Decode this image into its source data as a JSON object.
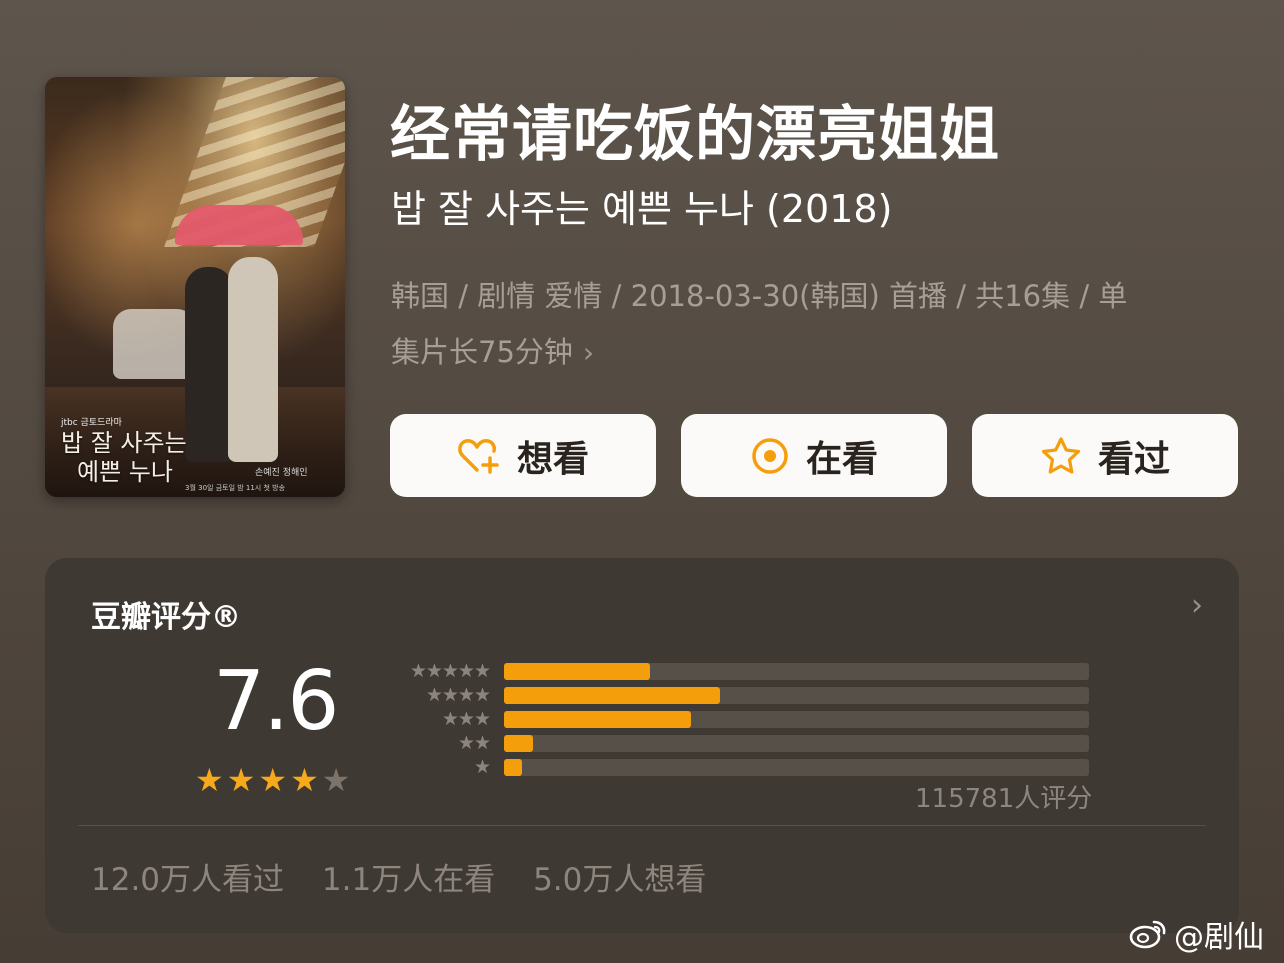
{
  "poster": {
    "logo_text": "jtbc 금토드라마",
    "title_line1": "밥 잘 사주는",
    "title_line2": "예쁜 누나",
    "credit": "손예진 정해인",
    "date_text": "3월 30일 금토일 밤 11시 첫 방송"
  },
  "show": {
    "title": "经常请吃饭的漂亮姐姐",
    "subtitle": "밥 잘 사주는 예쁜 누나 (2018)",
    "meta_line1": "韩国 / 剧情 爱情 / 2018-03-30(韩国) 首播 / 共16集 / 单",
    "meta_line2": "集片长75分钟"
  },
  "actions": {
    "want": "想看",
    "watching": "在看",
    "watched": "看过"
  },
  "rating": {
    "label": "豆瓣评分®",
    "score": "7.6",
    "stars_filled": 4,
    "stars_total": 5,
    "raters": "115781人评分",
    "distribution": [
      {
        "stars": 5,
        "fraction": 0.25
      },
      {
        "stars": 4,
        "fraction": 0.37
      },
      {
        "stars": 3,
        "fraction": 0.32
      },
      {
        "stars": 2,
        "fraction": 0.05
      },
      {
        "stars": 1,
        "fraction": 0.03
      }
    ]
  },
  "stats": {
    "watched": "12.0万人看过",
    "watching": "1.1万人在看",
    "want": "5.0万人想看"
  },
  "watermark": "@剧仙",
  "colors": {
    "accent": "#f59e0b",
    "button_bg": "#fbfaf8",
    "card_bg": "#3f3933"
  }
}
